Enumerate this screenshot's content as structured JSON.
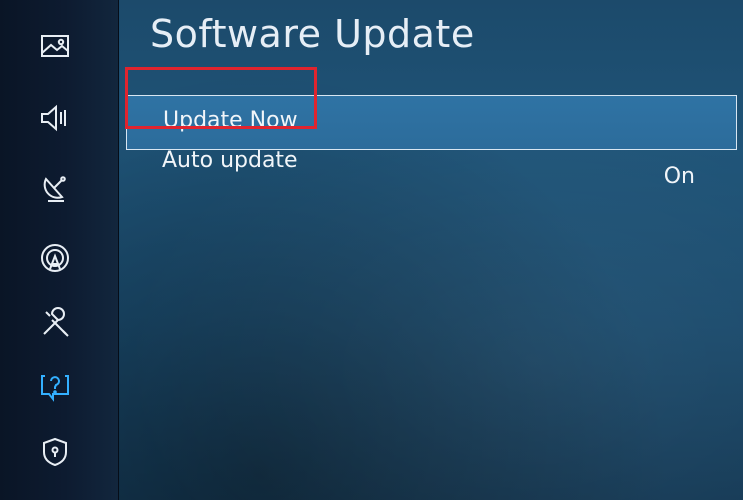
{
  "header": {
    "title": "Software Update"
  },
  "menu": {
    "items": [
      {
        "label": "Update Now",
        "value": ""
      },
      {
        "label": "Auto update",
        "value": "On"
      }
    ]
  },
  "sidebar": {
    "icons": [
      "picture-icon",
      "sound-icon",
      "broadcast-icon",
      "network-icon",
      "system-icon",
      "support-icon",
      "privacy-icon"
    ]
  },
  "colors": {
    "accent": "#2c6c9b",
    "highlight": "#e0242e"
  }
}
